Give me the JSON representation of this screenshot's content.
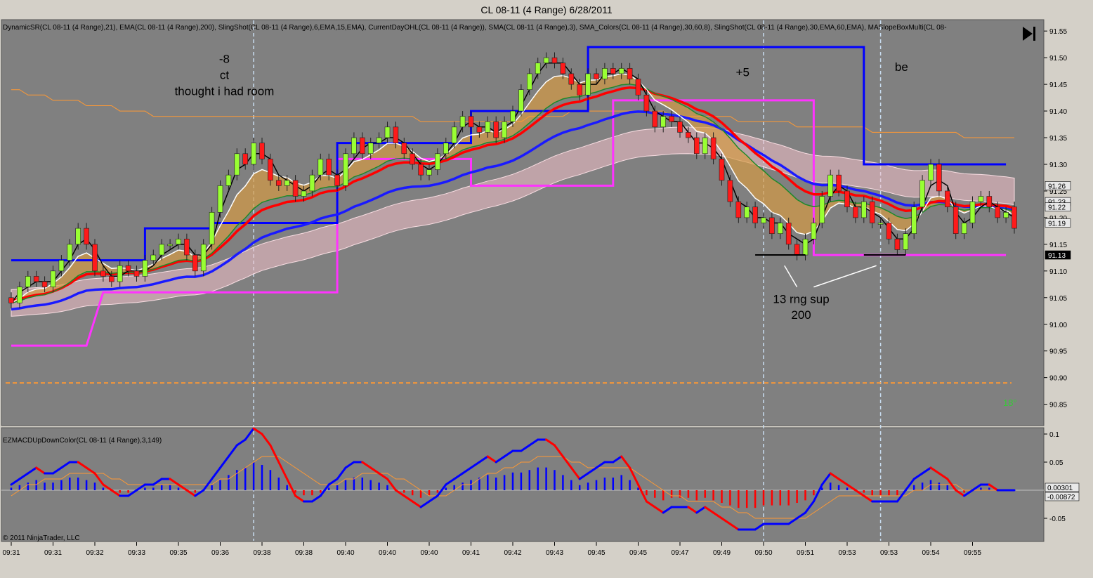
{
  "window": {
    "title": "CL 08-11 (4 Range)  6/28/2011"
  },
  "indicators_label": "DynamicSR(CL 08-11 (4 Range),21), EMA(CL 08-11 (4 Range),200), SlingShot(CL 08-11 (4 Range),6,EMA,15,EMA), CurrentDayOHL(CL 08-11 (4 Range)), SMA(CL 08-11 (4 Range),3), SMA_Colors(CL 08-11 (4 Range),30,60,8), SlingShot(CL 08-11 (4 Range),30,EMA,60,EMA), MASlopeBoxMulti(CL 08-",
  "lower_panel_label": "EZMACDUpDownColor(CL 08-11 (4 Range),3,149)",
  "copyright": "© 2011 NinjaTrader, LLC",
  "angle_label": "18°",
  "colors": {
    "up": "#99ff33",
    "down": "#ff1a1a",
    "sr": "#0000ff",
    "ohl": "#ff33ff",
    "ema200": "#ff9933",
    "fastema": "#ff0000",
    "macd_up": "#0000ff",
    "macd_down": "#ff0000",
    "background": "#808080"
  },
  "annotations": [
    {
      "text": "-8",
      "bar": 25.5,
      "price": 91.49
    },
    {
      "text": "ct",
      "bar": 25.5,
      "price": 91.46
    },
    {
      "text": "thought i had room",
      "bar": 25.5,
      "price": 91.43
    },
    {
      "text": "+5",
      "bar": 87.5,
      "price": 91.465
    },
    {
      "text": "be",
      "bar": 106.5,
      "price": 91.475
    },
    {
      "text": "13 rng sup",
      "bar": 94.5,
      "price": 91.04
    },
    {
      "text": "200",
      "bar": 94.5,
      "price": 91.01
    }
  ],
  "chart_data": [
    {
      "type": "candlestick",
      "y_range": [
        90.81,
        91.57
      ],
      "y_ticks": [
        "91.55",
        "91.50",
        "91.45",
        "91.40",
        "91.35",
        "91.30",
        "91.25",
        "91.20",
        "91.15",
        "91.10",
        "91.05",
        "91.00",
        "90.95",
        "90.90",
        "90.85"
      ],
      "x_tick_labels": [
        {
          "bar": 0,
          "label": "09:31"
        },
        {
          "bar": 5,
          "label": "09:31"
        },
        {
          "bar": 10,
          "label": "09:32"
        },
        {
          "bar": 15,
          "label": "09:33"
        },
        {
          "bar": 20,
          "label": "09:35"
        },
        {
          "bar": 25,
          "label": "09:36"
        },
        {
          "bar": 30,
          "label": "09:38"
        },
        {
          "bar": 35,
          "label": "09:38"
        },
        {
          "bar": 40,
          "label": "09:40"
        },
        {
          "bar": 45,
          "label": "09:40"
        },
        {
          "bar": 50,
          "label": "09:40"
        },
        {
          "bar": 55,
          "label": "09:41"
        },
        {
          "bar": 60,
          "label": "09:42"
        },
        {
          "bar": 65,
          "label": "09:43"
        },
        {
          "bar": 70,
          "label": "09:45"
        },
        {
          "bar": 75,
          "label": "09:45"
        },
        {
          "bar": 80,
          "label": "09:47"
        },
        {
          "bar": 85,
          "label": "09:49"
        },
        {
          "bar": 90,
          "label": "09:50"
        },
        {
          "bar": 95,
          "label": "09:51"
        },
        {
          "bar": 100,
          "label": "09:53"
        },
        {
          "bar": 105,
          "label": "09:53"
        },
        {
          "bar": 110,
          "label": "09:54"
        },
        {
          "bar": 115,
          "label": "09:55"
        }
      ],
      "price_tags": [
        {
          "price": 91.26,
          "label": "91.26",
          "dark": false
        },
        {
          "price": 91.23,
          "label": "91.23",
          "dark": false
        },
        {
          "price": 91.22,
          "label": "91.22",
          "dark": false
        },
        {
          "price": 91.19,
          "label": "91.19",
          "dark": false
        },
        {
          "price": 91.13,
          "label": "91.13",
          "dark": true
        }
      ],
      "session_lines_bars": [
        29,
        90,
        104
      ],
      "dotted_level": 90.89,
      "close": [
        91.04,
        91.07,
        91.09,
        91.08,
        91.07,
        91.1,
        91.12,
        91.15,
        91.18,
        91.15,
        91.1,
        91.09,
        91.08,
        91.11,
        91.1,
        91.09,
        91.12,
        91.13,
        91.15,
        91.15,
        91.16,
        91.13,
        91.1,
        91.15,
        91.21,
        91.26,
        91.28,
        91.32,
        91.3,
        91.34,
        91.31,
        91.27,
        91.26,
        91.27,
        91.24,
        91.25,
        91.28,
        91.31,
        91.28,
        91.26,
        91.32,
        91.35,
        91.32,
        91.34,
        91.35,
        91.37,
        91.34,
        91.32,
        91.3,
        91.28,
        91.29,
        91.32,
        91.34,
        91.37,
        91.39,
        91.37,
        91.36,
        91.38,
        91.35,
        91.38,
        91.4,
        91.44,
        91.47,
        91.49,
        91.5,
        91.49,
        91.47,
        91.45,
        91.43,
        91.47,
        91.46,
        91.48,
        91.47,
        91.48,
        91.46,
        91.43,
        91.4,
        91.37,
        91.39,
        91.38,
        91.36,
        91.35,
        91.32,
        91.35,
        91.31,
        91.27,
        91.23,
        91.2,
        91.22,
        91.19,
        91.2,
        91.17,
        91.19,
        91.15,
        91.13,
        91.16,
        91.19,
        91.24,
        91.28,
        91.25,
        91.22,
        91.2,
        91.23,
        91.19,
        91.19,
        91.16,
        91.14,
        91.17,
        91.22,
        91.27,
        91.3,
        91.25,
        91.22,
        91.17,
        91.19,
        91.23,
        91.24,
        91.22,
        91.2,
        91.21,
        91.18
      ],
      "open": [
        91.05,
        91.04,
        91.07,
        91.09,
        91.08,
        91.07,
        91.1,
        91.12,
        91.15,
        91.18,
        91.15,
        91.1,
        91.09,
        91.08,
        91.11,
        91.1,
        91.09,
        91.12,
        91.13,
        91.15,
        91.15,
        91.16,
        91.13,
        91.1,
        91.15,
        91.21,
        91.26,
        91.28,
        91.32,
        91.3,
        91.34,
        91.31,
        91.27,
        91.26,
        91.27,
        91.24,
        91.25,
        91.28,
        91.31,
        91.28,
        91.26,
        91.32,
        91.35,
        91.32,
        91.34,
        91.35,
        91.37,
        91.34,
        91.32,
        91.3,
        91.28,
        91.29,
        91.32,
        91.34,
        91.37,
        91.39,
        91.37,
        91.36,
        91.38,
        91.35,
        91.38,
        91.4,
        91.44,
        91.47,
        91.49,
        91.5,
        91.49,
        91.47,
        91.45,
        91.43,
        91.47,
        91.46,
        91.48,
        91.47,
        91.48,
        91.46,
        91.43,
        91.4,
        91.37,
        91.39,
        91.38,
        91.36,
        91.35,
        91.32,
        91.35,
        91.31,
        91.27,
        91.23,
        91.2,
        91.22,
        91.19,
        91.2,
        91.17,
        91.19,
        91.15,
        91.13,
        91.16,
        91.19,
        91.24,
        91.28,
        91.25,
        91.22,
        91.2,
        91.23,
        91.19,
        91.19,
        91.16,
        91.14,
        91.17,
        91.22,
        91.27,
        91.3,
        91.25,
        91.22,
        91.17,
        91.19,
        91.23,
        91.24,
        91.22,
        91.2,
        91.22
      ],
      "sma3": [
        91.04,
        91.06,
        91.07,
        91.08,
        91.08,
        91.08,
        91.1,
        91.12,
        91.15,
        91.16,
        91.14,
        91.11,
        91.09,
        91.09,
        91.1,
        91.1,
        91.1,
        91.11,
        91.13,
        91.14,
        91.15,
        91.15,
        91.13,
        91.13,
        91.15,
        91.21,
        91.25,
        91.29,
        91.3,
        91.32,
        91.32,
        91.31,
        91.28,
        91.27,
        91.26,
        91.25,
        91.26,
        91.28,
        91.29,
        91.28,
        91.29,
        91.31,
        91.33,
        91.34,
        91.34,
        91.35,
        91.35,
        91.34,
        91.32,
        91.3,
        91.29,
        91.3,
        91.32,
        91.34,
        91.37,
        91.38,
        91.37,
        91.37,
        91.36,
        91.37,
        91.38,
        91.41,
        91.44,
        91.47,
        91.49,
        91.49,
        91.49,
        91.47,
        91.45,
        91.45,
        91.45,
        91.47,
        91.47,
        91.48,
        91.47,
        91.46,
        91.43,
        91.4,
        91.39,
        91.38,
        91.38,
        91.36,
        91.34,
        91.34,
        91.33,
        91.31,
        91.27,
        91.23,
        91.22,
        91.2,
        91.2,
        91.19,
        91.19,
        91.17,
        91.16,
        91.15,
        91.16,
        91.2,
        91.24,
        91.26,
        91.25,
        91.22,
        91.22,
        91.21,
        91.2,
        91.18,
        91.16,
        91.16,
        91.18,
        91.22,
        91.26,
        91.27,
        91.26,
        91.21,
        91.19,
        91.2,
        91.22,
        91.23,
        91.22,
        91.21,
        91.2
      ],
      "ema200": [
        91.44,
        91.44,
        91.43,
        91.43,
        91.43,
        91.42,
        91.42,
        91.42,
        91.42,
        91.41,
        91.41,
        91.41,
        91.41,
        91.4,
        91.4,
        91.4,
        91.4,
        91.39,
        91.39,
        91.39,
        91.39,
        91.39,
        91.39,
        91.39,
        91.39,
        91.39,
        91.39,
        91.39,
        91.39,
        91.39,
        91.39,
        91.39,
        91.39,
        91.39,
        91.39,
        91.39,
        91.39,
        91.39,
        91.39,
        91.39,
        91.39,
        91.39,
        91.39,
        91.39,
        91.39,
        91.39,
        91.39,
        91.39,
        91.39,
        91.38,
        91.38,
        91.38,
        91.38,
        91.38,
        91.38,
        91.38,
        91.38,
        91.38,
        91.38,
        91.38,
        91.38,
        91.38,
        91.39,
        91.39,
        91.39,
        91.39,
        91.39,
        91.4,
        91.4,
        91.4,
        91.4,
        91.4,
        91.4,
        91.4,
        91.4,
        91.4,
        91.4,
        91.4,
        91.4,
        91.39,
        91.39,
        91.39,
        91.39,
        91.39,
        91.39,
        91.39,
        91.39,
        91.38,
        91.38,
        91.38,
        91.38,
        91.38,
        91.38,
        91.38,
        91.37,
        91.37,
        91.37,
        91.37,
        91.37,
        91.37,
        91.37,
        91.37,
        91.37,
        91.36,
        91.36,
        91.36,
        91.36,
        91.36,
        91.36,
        91.36,
        91.36,
        91.36,
        91.36,
        91.36,
        91.35,
        91.35,
        91.35,
        91.35,
        91.35,
        91.35,
        91.35
      ],
      "dynamic_sr": [
        [
          0,
          91.12
        ],
        [
          16,
          91.12
        ],
        [
          16,
          91.18
        ],
        [
          24,
          91.18
        ],
        [
          24,
          91.19
        ],
        [
          39,
          91.19
        ],
        [
          39,
          91.34
        ],
        [
          55,
          91.34
        ],
        [
          55,
          91.4
        ],
        [
          69,
          91.4
        ],
        [
          69,
          91.52
        ],
        [
          102,
          91.52
        ],
        [
          102,
          91.3
        ],
        [
          119,
          91.3
        ]
      ],
      "current_day_ohl": [
        [
          0,
          90.96
        ],
        [
          9,
          90.96
        ],
        [
          11,
          91.06
        ],
        [
          39,
          91.06
        ],
        [
          39,
          91.31
        ],
        [
          55,
          91.31
        ],
        [
          55,
          91.26
        ],
        [
          72,
          91.26
        ],
        [
          72,
          91.42
        ],
        [
          96,
          91.42
        ],
        [
          96,
          91.13
        ],
        [
          119,
          91.13
        ]
      ]
    },
    {
      "type": "bar",
      "y_range": [
        -0.09,
        0.11
      ],
      "y_ticks": [
        "0.1",
        "0.05",
        "-0.05"
      ],
      "value_tags": [
        {
          "value": 0.00301,
          "label": "0.00301"
        },
        {
          "value": -0.00872,
          "label": "-0.00872"
        }
      ],
      "macd": [
        0.01,
        0.02,
        0.03,
        0.04,
        0.03,
        0.03,
        0.04,
        0.05,
        0.05,
        0.04,
        0.03,
        0.01,
        0.0,
        -0.01,
        -0.01,
        0.0,
        0.01,
        0.01,
        0.02,
        0.02,
        0.01,
        0.0,
        -0.01,
        0.0,
        0.02,
        0.04,
        0.06,
        0.08,
        0.09,
        0.11,
        0.1,
        0.08,
        0.05,
        0.02,
        -0.01,
        -0.02,
        -0.02,
        -0.01,
        0.01,
        0.02,
        0.04,
        0.05,
        0.05,
        0.04,
        0.03,
        0.02,
        0.0,
        -0.01,
        -0.02,
        -0.03,
        -0.02,
        -0.01,
        0.01,
        0.02,
        0.03,
        0.04,
        0.05,
        0.06,
        0.05,
        0.06,
        0.07,
        0.07,
        0.08,
        0.09,
        0.09,
        0.08,
        0.06,
        0.04,
        0.02,
        0.03,
        0.04,
        0.05,
        0.05,
        0.06,
        0.04,
        0.01,
        -0.02,
        -0.03,
        -0.04,
        -0.03,
        -0.03,
        -0.03,
        -0.04,
        -0.03,
        -0.04,
        -0.05,
        -0.06,
        -0.07,
        -0.07,
        -0.07,
        -0.06,
        -0.06,
        -0.06,
        -0.06,
        -0.05,
        -0.04,
        -0.02,
        0.01,
        0.03,
        0.02,
        0.01,
        0.0,
        -0.01,
        -0.02,
        -0.02,
        -0.02,
        -0.02,
        0.0,
        0.02,
        0.03,
        0.04,
        0.03,
        0.02,
        0.0,
        -0.01,
        0.0,
        0.01,
        0.01,
        0.0,
        0.0,
        0.0
      ],
      "signal": [
        -0.01,
        0.0,
        0.01,
        0.01,
        0.02,
        0.02,
        0.02,
        0.03,
        0.03,
        0.03,
        0.03,
        0.03,
        0.02,
        0.02,
        0.01,
        0.01,
        0.01,
        0.01,
        0.01,
        0.01,
        0.01,
        0.01,
        0.01,
        0.01,
        0.01,
        0.02,
        0.02,
        0.03,
        0.04,
        0.05,
        0.06,
        0.06,
        0.06,
        0.05,
        0.04,
        0.03,
        0.02,
        0.01,
        0.01,
        0.01,
        0.02,
        0.02,
        0.03,
        0.03,
        0.03,
        0.03,
        0.02,
        0.02,
        0.01,
        0.0,
        -0.01,
        -0.01,
        -0.01,
        0.0,
        0.01,
        0.01,
        0.02,
        0.03,
        0.03,
        0.04,
        0.04,
        0.05,
        0.05,
        0.06,
        0.06,
        0.06,
        0.06,
        0.05,
        0.05,
        0.04,
        0.04,
        0.04,
        0.04,
        0.04,
        0.04,
        0.03,
        0.02,
        0.01,
        0.0,
        -0.01,
        -0.01,
        -0.02,
        -0.02,
        -0.02,
        -0.02,
        -0.03,
        -0.03,
        -0.04,
        -0.04,
        -0.05,
        -0.05,
        -0.05,
        -0.05,
        -0.05,
        -0.05,
        -0.05,
        -0.04,
        -0.03,
        -0.02,
        -0.01,
        -0.01,
        -0.01,
        -0.01,
        -0.01,
        -0.01,
        -0.01,
        -0.01,
        -0.01,
        0.0,
        0.0,
        0.01,
        0.01,
        0.01,
        0.01,
        0.0,
        0.0,
        0.0,
        0.0,
        0.0,
        0.0,
        0.0
      ]
    }
  ]
}
